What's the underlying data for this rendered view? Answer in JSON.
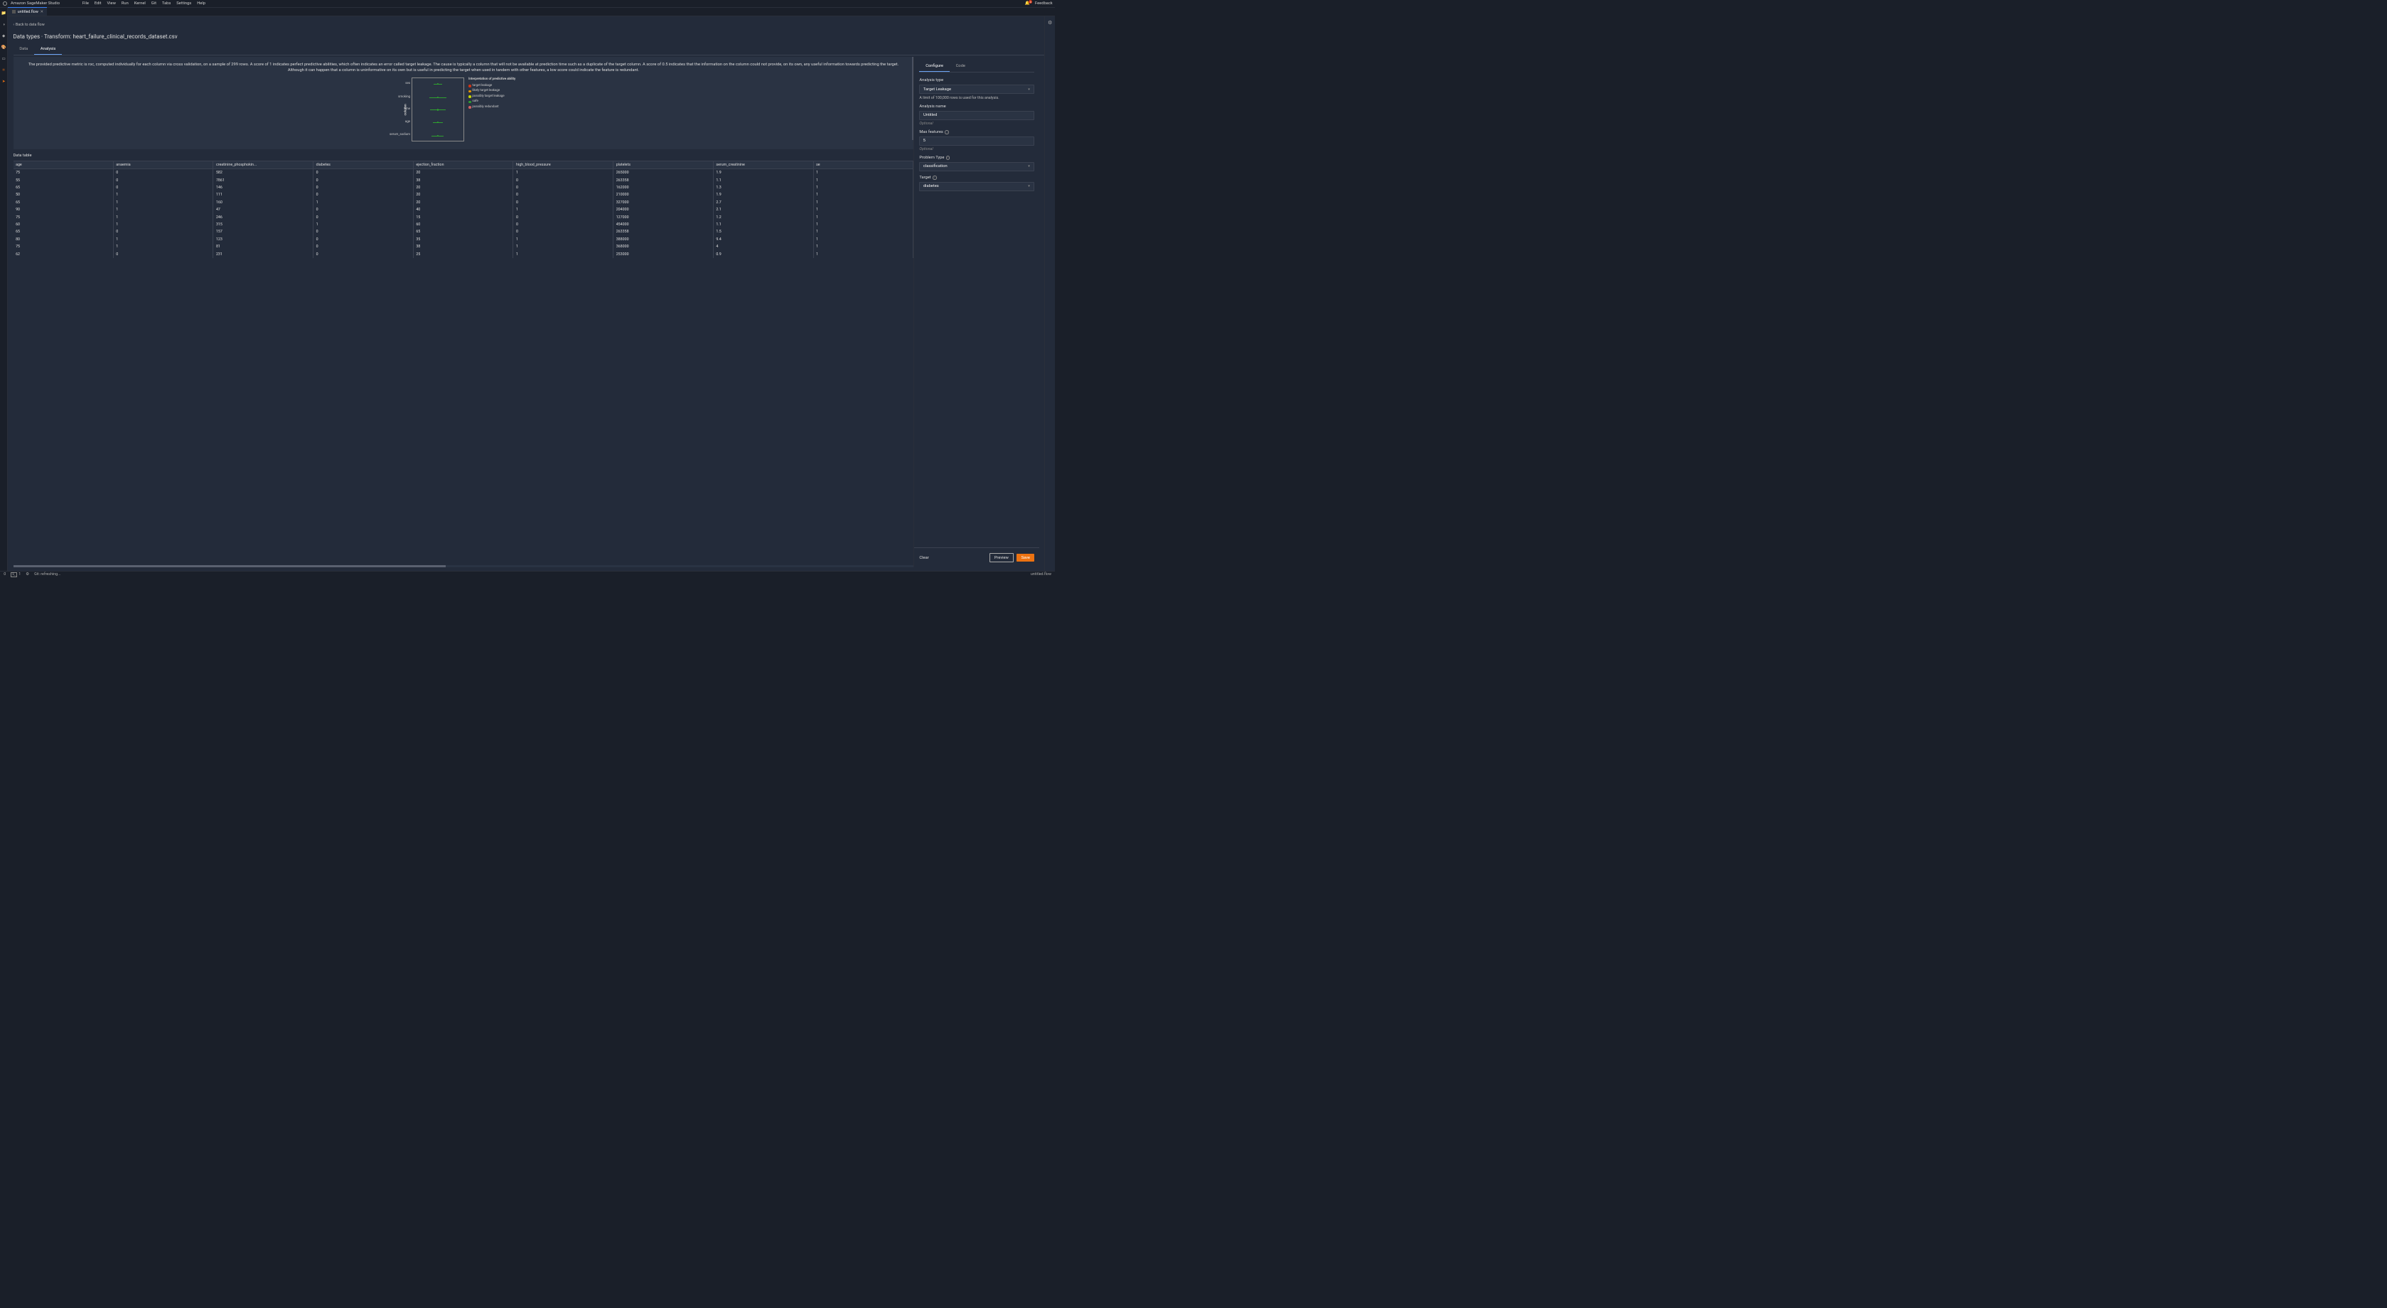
{
  "app": {
    "title": "Amazon SageMaker Studio"
  },
  "menubar": [
    "File",
    "Edit",
    "View",
    "Run",
    "Kernel",
    "Git",
    "Tabs",
    "Settings",
    "Help"
  ],
  "topbar": {
    "notification_count": "4",
    "feedback": "Feedback"
  },
  "left_rail": [
    "folder",
    "git-square",
    "diamond",
    "palette",
    "rect",
    "nodes",
    "send"
  ],
  "tab": {
    "name": "untitled.flow"
  },
  "back_link": "Back to data flow",
  "page_title": "Data types · Transform: heart_failure_clinical_records_dataset.csv",
  "subtabs": {
    "data": "Data",
    "analysis": "Analysis"
  },
  "description": "The provided predictive metric is roc, computed individually for each column via cross validation, on a sample of 299 rows. A score of 1 indicates perfect predictive abilities, which often indicates an error called target leakage. The cause is typically a column that will not be available at prediction time such as a duplicate of the target column. A score of 0.5 indicates that the information on the column could not provide, on its own, any useful information towards predicting the target. Although it can happen that a column is uninformative on its own but is useful in predicting the target when used in tandem with other features, a low score could indicate the feature is redundant.",
  "chart_data": {
    "type": "scatter",
    "ylabel": "column",
    "legend_title": "Interpretation of predictive ability",
    "legend": [
      {
        "label": "target leakage",
        "color": "#d13212"
      },
      {
        "label": "likely target leakage",
        "color": "#e69400"
      },
      {
        "label": "possibly target leakage",
        "color": "#c8d600"
      },
      {
        "label": "safe",
        "color": "#2fa02f"
      },
      {
        "label": "possibly redundant",
        "color": "#d16060"
      }
    ],
    "series": [
      {
        "name": "sex",
        "status": "safe"
      },
      {
        "name": "smoking",
        "status": "safe"
      },
      {
        "name": "time",
        "status": "safe"
      },
      {
        "name": "age",
        "status": "safe"
      },
      {
        "name": "serum_sodium",
        "status": "safe"
      }
    ]
  },
  "data_table_label": "Data table",
  "table": {
    "columns": [
      "age",
      "anaemia",
      "creatinine_phosphokin...",
      "diabetes",
      "ejection_fraction",
      "high_blood_pressure",
      "platelets",
      "serum_creatinine",
      "se"
    ],
    "rows": [
      [
        "75",
        "0",
        "582",
        "0",
        "20",
        "1",
        "265000",
        "1.9",
        "1"
      ],
      [
        "55",
        "0",
        "7861",
        "0",
        "38",
        "0",
        "263358",
        "1.1",
        "1"
      ],
      [
        "65",
        "0",
        "146",
        "0",
        "20",
        "0",
        "162000",
        "1.3",
        "1"
      ],
      [
        "50",
        "1",
        "111",
        "0",
        "20",
        "0",
        "210000",
        "1.9",
        "1"
      ],
      [
        "65",
        "1",
        "160",
        "1",
        "20",
        "0",
        "327000",
        "2.7",
        "1"
      ],
      [
        "90",
        "1",
        "47",
        "0",
        "40",
        "1",
        "204000",
        "2.1",
        "1"
      ],
      [
        "75",
        "1",
        "246",
        "0",
        "15",
        "0",
        "127000",
        "1.2",
        "1"
      ],
      [
        "60",
        "1",
        "315",
        "1",
        "60",
        "0",
        "454000",
        "1.1",
        "1"
      ],
      [
        "65",
        "0",
        "157",
        "0",
        "65",
        "0",
        "263358",
        "1.5",
        "1"
      ],
      [
        "80",
        "1",
        "123",
        "0",
        "35",
        "1",
        "388000",
        "9.4",
        "1"
      ],
      [
        "75",
        "1",
        "81",
        "0",
        "38",
        "1",
        "368000",
        "4",
        "1"
      ],
      [
        "62",
        "0",
        "231",
        "0",
        "25",
        "1",
        "253000",
        "0.9",
        "1"
      ]
    ]
  },
  "config": {
    "tabs": {
      "configure": "Configure",
      "code": "Code"
    },
    "analysis_type_label": "Analysis type",
    "analysis_type_value": "Target Leakage",
    "rows_note": "A limit of 100,000 rows is used for this analysis.",
    "analysis_name_label": "Analysis name",
    "analysis_name_value": "Untitled",
    "optional": "Optional",
    "max_features_label": "Max features",
    "max_features_value": "5",
    "problem_type_label": "Problem Type",
    "problem_type_value": "classification",
    "target_label": "Target",
    "target_value": "diabetes",
    "clear": "Clear",
    "preview": "Preview",
    "save": "Save"
  },
  "status": {
    "zero": "0",
    "one": "1",
    "term_label": "$_",
    "git": "Git: refreshing...",
    "file": "untitled.flow"
  }
}
